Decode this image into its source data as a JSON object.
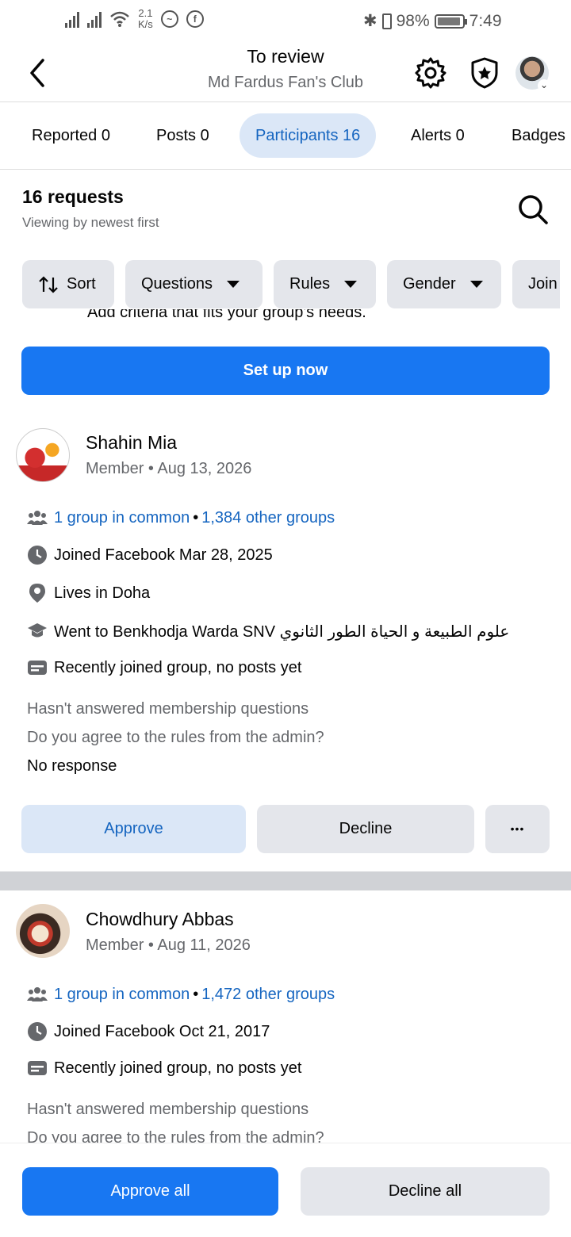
{
  "status_bar": {
    "net_speed_top": "2.1",
    "net_speed_bottom": "K/s",
    "battery": "98%",
    "time": "7:49"
  },
  "header": {
    "title": "To review",
    "subtitle": "Md Fardus Fan's Club"
  },
  "tabs": [
    {
      "label": "Reported 0"
    },
    {
      "label": "Posts 0"
    },
    {
      "label": "Participants 16"
    },
    {
      "label": "Alerts 0"
    },
    {
      "label": "Badges"
    }
  ],
  "requests": {
    "title": "16 requests",
    "subtitle": "Viewing by newest first"
  },
  "filters": [
    {
      "label": "Sort"
    },
    {
      "label": "Questions"
    },
    {
      "label": "Rules"
    },
    {
      "label": "Gender"
    },
    {
      "label": "Join"
    }
  ],
  "criteria_text": "Add criteria that fits your group's needs.",
  "setup_button": "Set up now",
  "members": [
    {
      "name": "Shahin Mia",
      "meta": "Member • Aug 13, 2026",
      "groups_common": "1 group in common",
      "other_groups": "1,384 other groups",
      "joined": "Joined Facebook Mar 28, 2025",
      "lives": "Lives in Doha",
      "education": "Went to Benkhodja Warda SNV علوم الطبيعة و الحياة الطور الثانوي",
      "activity": "Recently joined group, no posts yet",
      "q1": "Hasn't answered membership questions",
      "q2": "Do you agree to the rules from the admin?",
      "q2_answer": "No response",
      "approve": "Approve",
      "decline": "Decline",
      "more": "•••"
    },
    {
      "name": "Chowdhury Abbas",
      "meta": "Member • Aug 11, 2026",
      "groups_common": "1 group in common",
      "other_groups": "1,472 other groups",
      "joined": "Joined Facebook Oct 21, 2017",
      "activity": "Recently joined group, no posts yet",
      "q1": "Hasn't answered membership questions",
      "q2": "Do you agree to the rules from the admin?"
    }
  ],
  "bottom": {
    "approve_all": "Approve all",
    "decline_all": "Decline all"
  }
}
